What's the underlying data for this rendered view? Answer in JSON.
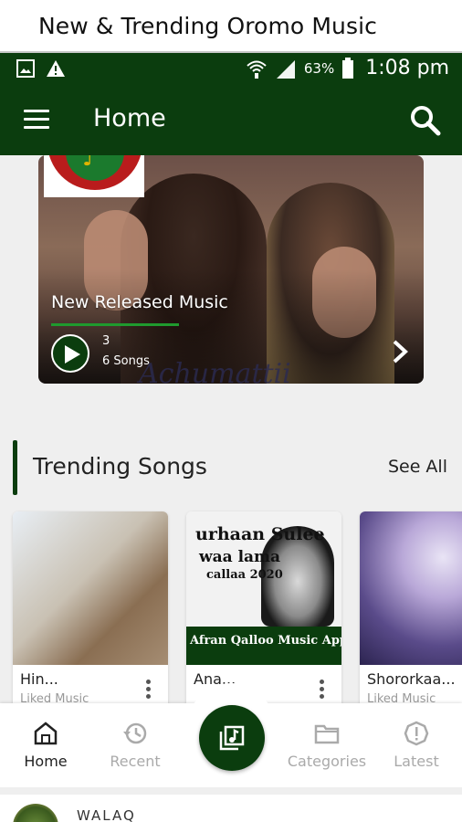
{
  "caption": "New & Trending Oromo Music",
  "status_bar": {
    "battery": "63%",
    "time": "1:08 pm"
  },
  "app_bar": {
    "title": "Home"
  },
  "banner": {
    "title": "New Released Music",
    "count": "3",
    "songs": "6 Songs",
    "watermark": "Achumattii"
  },
  "trending": {
    "title": "Trending Songs",
    "see_all": "See All",
    "cards": [
      {
        "title": "Hin...",
        "subtitle": "Liked Music"
      },
      {
        "title": "Ana...",
        "subtitle": "",
        "art_line1": "urhaan Sulee",
        "art_line2": "waa lama",
        "art_line3": "callaa 2020",
        "art_band": "Afran Qalloo Music App"
      },
      {
        "title": "Shororkaa...",
        "subtitle": "Liked Music"
      }
    ]
  },
  "bottom_nav": {
    "items": [
      {
        "label": "Home",
        "icon": "home-icon",
        "active": true
      },
      {
        "label": "Recent",
        "icon": "history-icon",
        "active": false
      },
      {
        "label": "Categories",
        "icon": "folder-icon",
        "active": false
      },
      {
        "label": "Latest",
        "icon": "alert-icon",
        "active": false
      }
    ],
    "fab_icon": "music-library-icon"
  },
  "bottom_strip": {
    "title": "WALAQ"
  },
  "colors": {
    "primary": "#0b3d0e",
    "accent": "#1f9a2e",
    "background": "#efefef"
  }
}
